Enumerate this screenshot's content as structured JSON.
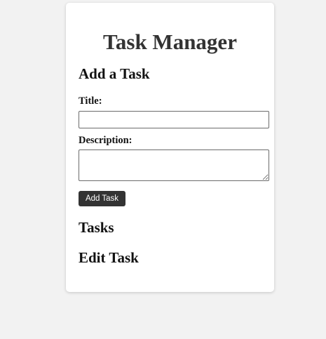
{
  "app": {
    "title": "Task Manager"
  },
  "add_task": {
    "heading": "Add a Task",
    "title_label": "Title:",
    "title_value": "",
    "description_label": "Description:",
    "description_value": "",
    "button_label": "Add Task"
  },
  "tasks": {
    "heading": "Tasks",
    "items": []
  },
  "edit_task": {
    "heading": "Edit Task"
  },
  "colors": {
    "page_background": "#f2f2f2",
    "card_background": "#ffffff",
    "title_text": "#333333",
    "button_background": "#333333",
    "button_text": "#ffffff"
  }
}
